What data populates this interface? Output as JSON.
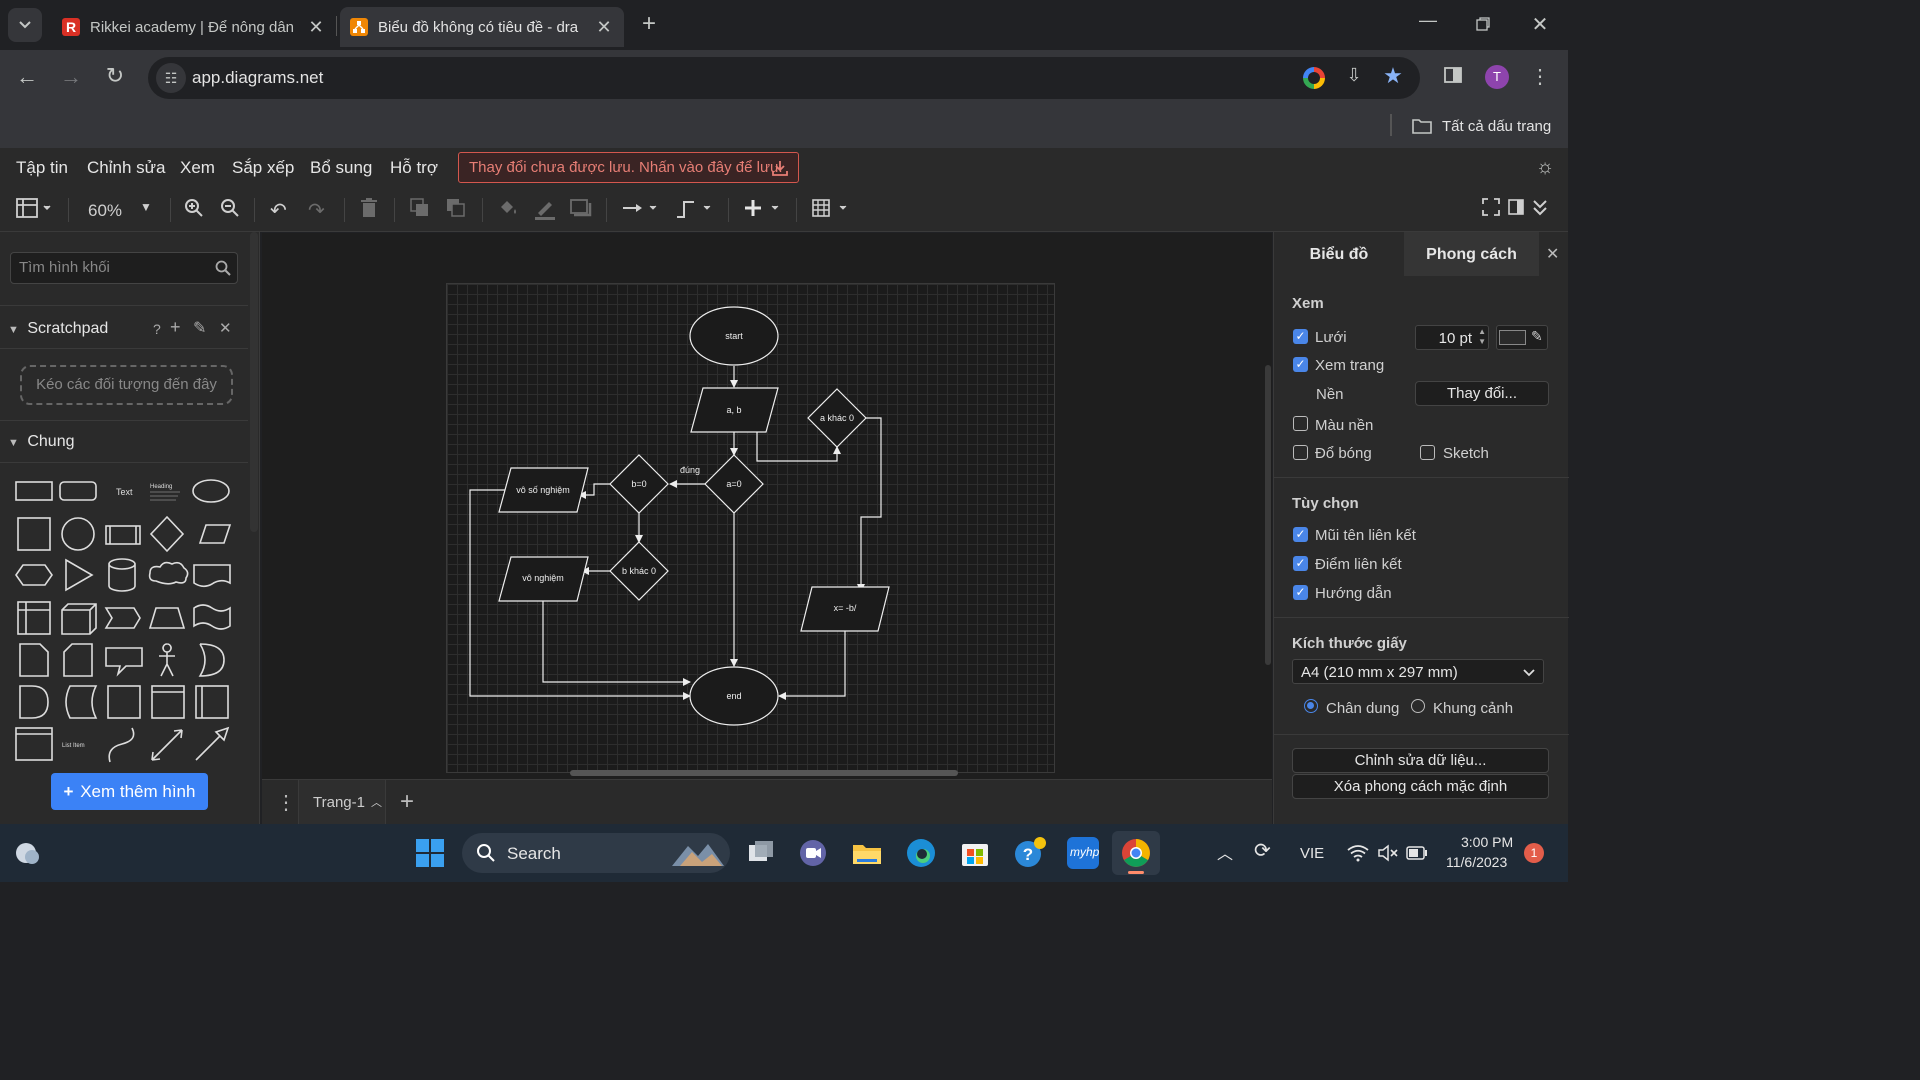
{
  "browser": {
    "tabs": [
      {
        "title": "Rikkei academy | Để nông dân",
        "active": false
      },
      {
        "title": "Biểu đồ không có tiêu đề - dra",
        "active": true
      }
    ],
    "url": "app.diagrams.net",
    "profile_initial": "T",
    "bookmarks_label": "Tất cả dấu trang"
  },
  "menu": {
    "items": [
      "Tập tin",
      "Chỉnh sửa",
      "Xem",
      "Sắp xếp",
      "Bổ sung",
      "Hỗ trợ"
    ],
    "unsaved_notice": "Thay đổi chưa được lưu. Nhấn vào đây để lưu."
  },
  "toolbar": {
    "zoom": "60%"
  },
  "left_panel": {
    "search_placeholder": "Tìm hình khối",
    "scratchpad_title": "Scratchpad",
    "scratchpad_help": "?",
    "dropzone_text": "Kéo các đối tượng đến đây",
    "general_title": "Chung",
    "shape_text": "Text",
    "shape_heading": "Heading",
    "shape_list_item": "List Item",
    "more_shapes": "Xem thêm hình"
  },
  "diagram": {
    "nodes": {
      "start": "start",
      "input": "a, b",
      "a_neq_0": "a khác 0",
      "a_eq_0": "a=0",
      "b_eq_0": "b=0",
      "b_neq_0": "b khác 0",
      "infinite": "vô số nghiệm",
      "none": "vô nghiệm",
      "solution": "x= -b/",
      "end": "end"
    },
    "edge_label_true": "đúng"
  },
  "page_bar": {
    "page_name": "Trang-1"
  },
  "right_panel": {
    "tab_diagram": "Biểu đồ",
    "tab_style": "Phong cách",
    "view_title": "Xem",
    "grid_label": "Lưới",
    "grid_checked": true,
    "grid_size": "10 pt",
    "page_view_label": "Xem trang",
    "page_view_checked": true,
    "background_label": "Nền",
    "change_button": "Thay đổi...",
    "bg_color_label": "Màu nền",
    "bg_color_checked": false,
    "shadow_label": "Đổ bóng",
    "shadow_checked": false,
    "sketch_label": "Sketch",
    "sketch_checked": false,
    "options_title": "Tùy chọn",
    "connection_arrows": "Mũi tên liên kết",
    "connection_points": "Điểm liên kết",
    "guides": "Hướng dẫn",
    "paper_size_title": "Kích thước giấy",
    "paper_size": "A4 (210 mm x 297 mm)",
    "portrait": "Chân dung",
    "landscape": "Khung cảnh",
    "orientation": "portrait",
    "edit_data": "Chỉnh sửa dữ liệu...",
    "clear_style": "Xóa phong cách mặc định"
  },
  "taskbar": {
    "search": "Search",
    "language": "VIE",
    "time": "3:00 PM",
    "date": "11/6/2023",
    "notifications": "1"
  }
}
